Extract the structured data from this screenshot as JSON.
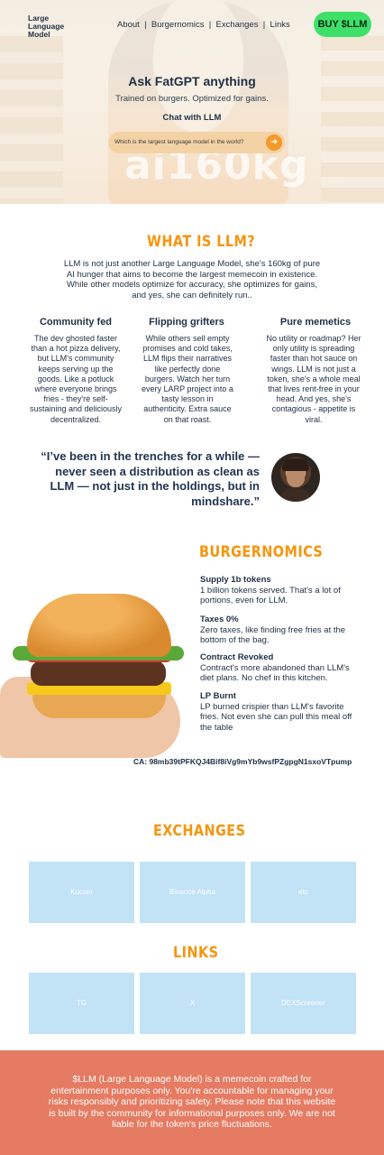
{
  "header": {
    "logo_text": "Large Language Model",
    "nav": [
      "About",
      "Burgernomics",
      "Exchanges",
      "Links"
    ],
    "buy_label": "BUY $LLM"
  },
  "hero": {
    "watermark": "ai160kg",
    "title": "Ask FatGPT anything",
    "subtitle": "Trained on burgers. Optimized for gains.",
    "chat_label": "Chat with LLM",
    "chat_placeholder": "Which is the largest language model in the world?",
    "send_icon": "arrow-right-icon"
  },
  "about": {
    "title": "WHAT IS LLM?",
    "intro": "LLM is not just another Large Language Model, she's 160kg of pure AI hunger that aims to become the largest memecoin in existence. While other models optimize for accuracy, she optimizes for gains, and yes, she can definitely run..",
    "columns": [
      {
        "title": "Community fed",
        "text": "The dev ghosted faster than a hot pizza delivery, but LLM's community keeps serving up the goods. Like a potluck where everyone brings fries - they're self-sustaining and deliciously decentralized."
      },
      {
        "title": "Flipping grifters",
        "text": "While others sell empty promises and cold takes, LLM flips their narratives like perfectly done burgers. Watch her turn every LARP project into a tasty lesson in authenticity. Extra sauce on that roast."
      },
      {
        "title": "Pure memetics",
        "text": "No utility or roadmap? Her only utility is spreading faster than hot sauce on wings. LLM is not just a token, she's a whole meal that lives rent-free in your head. And yes, she's contagious - appetite is viral."
      }
    ],
    "quote": "“I’ve been in the trenches for a while — never seen a distribution as clean as LLM — not just in the holdings, but in mindshare.”"
  },
  "burgernomics": {
    "title": "BURGERNOMICS",
    "items": [
      {
        "title": "Supply 1b tokens",
        "text": "1 billion tokens served. That's a lot of portions, even for LLM."
      },
      {
        "title": "Taxes 0%",
        "text": "Zero taxes, like finding free fries at the bottom of the bag."
      },
      {
        "title": "Contract Revoked",
        "text": "Contract's more abandoned than LLM's diet plans. No chef in this kitchen."
      },
      {
        "title": "LP Burnt",
        "text": "LP burned crispier than LLM's favorite fries. Not even she can pull this meal off the table"
      }
    ],
    "ca": "CA: 98mb39tPFKQJ4Bif8iVg9mYb9wsfPZgpgN1sxoVTpump"
  },
  "exchanges": {
    "title": "EXCHANGES",
    "items": [
      "Kucoin",
      "Binance Alpha",
      "etc"
    ]
  },
  "links": {
    "title": "LINKS",
    "items": [
      "TG",
      "X",
      "DEXScreener"
    ]
  },
  "footer": {
    "text": "$LLM (Large Language Model) is a memecoin crafted for entertainment purposes only. You're accountable for managing your risks responsibly and prioritizing safety. Please note that this website is built by the community for informational purposes only. We are not liable for the token's price fluctuations."
  },
  "colors": {
    "accent": "#f5950f",
    "buy_button": "#3ee06a",
    "tile": "#c2e2f6",
    "footer": "#e57b62",
    "text": "#1f2f45"
  }
}
